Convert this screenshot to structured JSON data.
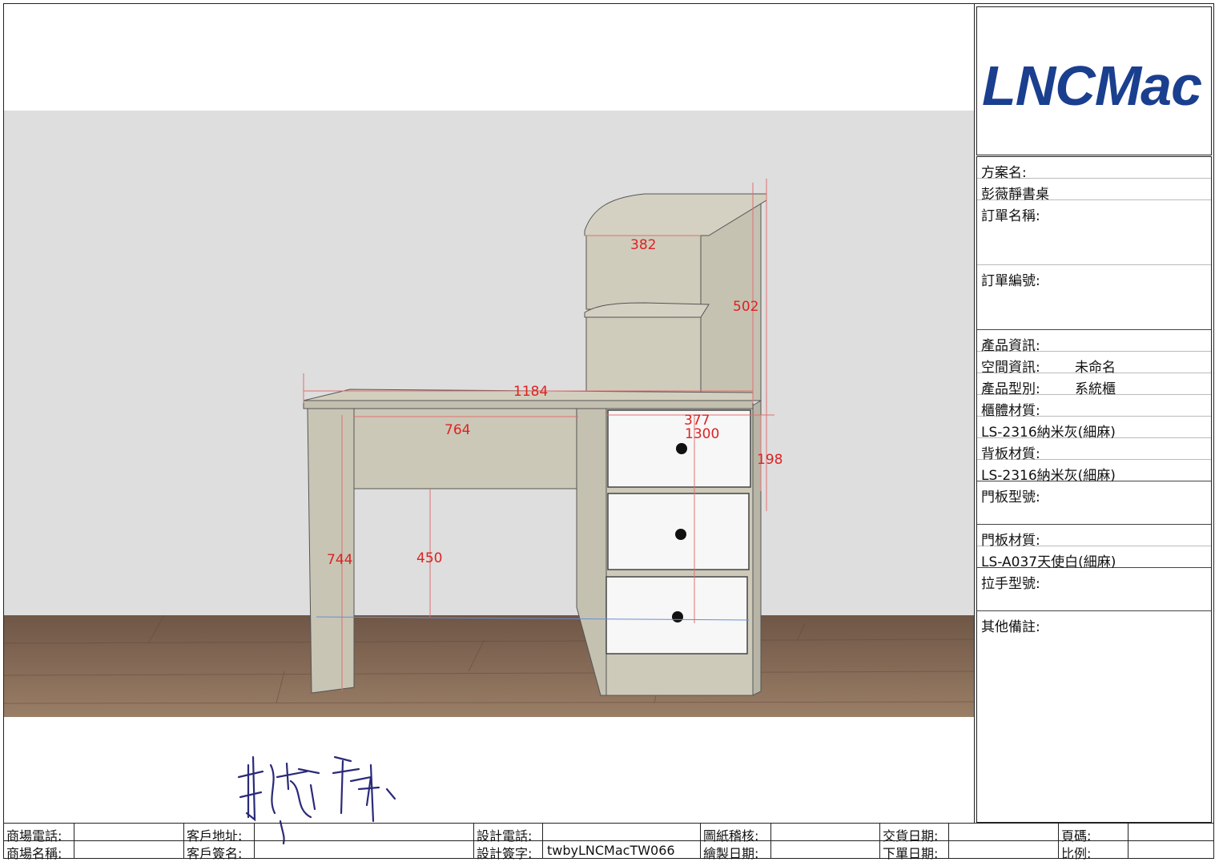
{
  "logo": "LNCMac",
  "sidebar": {
    "plan_label": "方案名:",
    "plan_value": "彭薇靜書桌",
    "order_name_label": "訂單名稱:",
    "order_no_label": "訂單編號:",
    "product_info_label": "產品資訊:",
    "space_info_label": "空間資訊:",
    "space_info_value": "未命名",
    "product_type_label": "產品型別:",
    "product_type_value": "系統櫃",
    "cabinet_material_label": "櫃體材質:",
    "cabinet_material_value": "LS-2316納米灰(細麻)",
    "back_material_label": "背板材質:",
    "back_material_value": "LS-2316納米灰(細麻)",
    "door_model_label": "門板型號:",
    "door_material_label": "門板材質:",
    "door_material_value": "LS-A037天使白(細麻)",
    "handle_model_label": "拉手型號:",
    "remarks_label": "其他備註:"
  },
  "dimensions": {
    "hutch_width": "382",
    "hutch_height": "502",
    "desk_width": "1184",
    "cabinet_width": "377",
    "total_height": "1300",
    "drawer_height": "198",
    "knee_width": "764",
    "desk_height": "744",
    "knee_height": "450"
  },
  "footer": {
    "shop_phone": "商場電話:",
    "shop_name": "商場名稱:",
    "client_address": "客戶地址:",
    "client_signature": "客戶簽名:",
    "design_phone": "設計電話:",
    "design_signature": "設計簽字:",
    "design_signature_value": "twbyLNCMacTW066",
    "drawing_review": "圖紙稽核:",
    "draw_date": "繪製日期:",
    "delivery_date": "交貨日期:",
    "order_date": "下單日期:",
    "page_no": "頁碼:",
    "scale": "比例:"
  },
  "colors": {
    "logo": "#1a3f8f",
    "dimension": "#d22",
    "wall": "#dedede",
    "cabinet": "#c9c6b6",
    "drawer": "#f7f7f7",
    "floor": "#8a6e58"
  }
}
